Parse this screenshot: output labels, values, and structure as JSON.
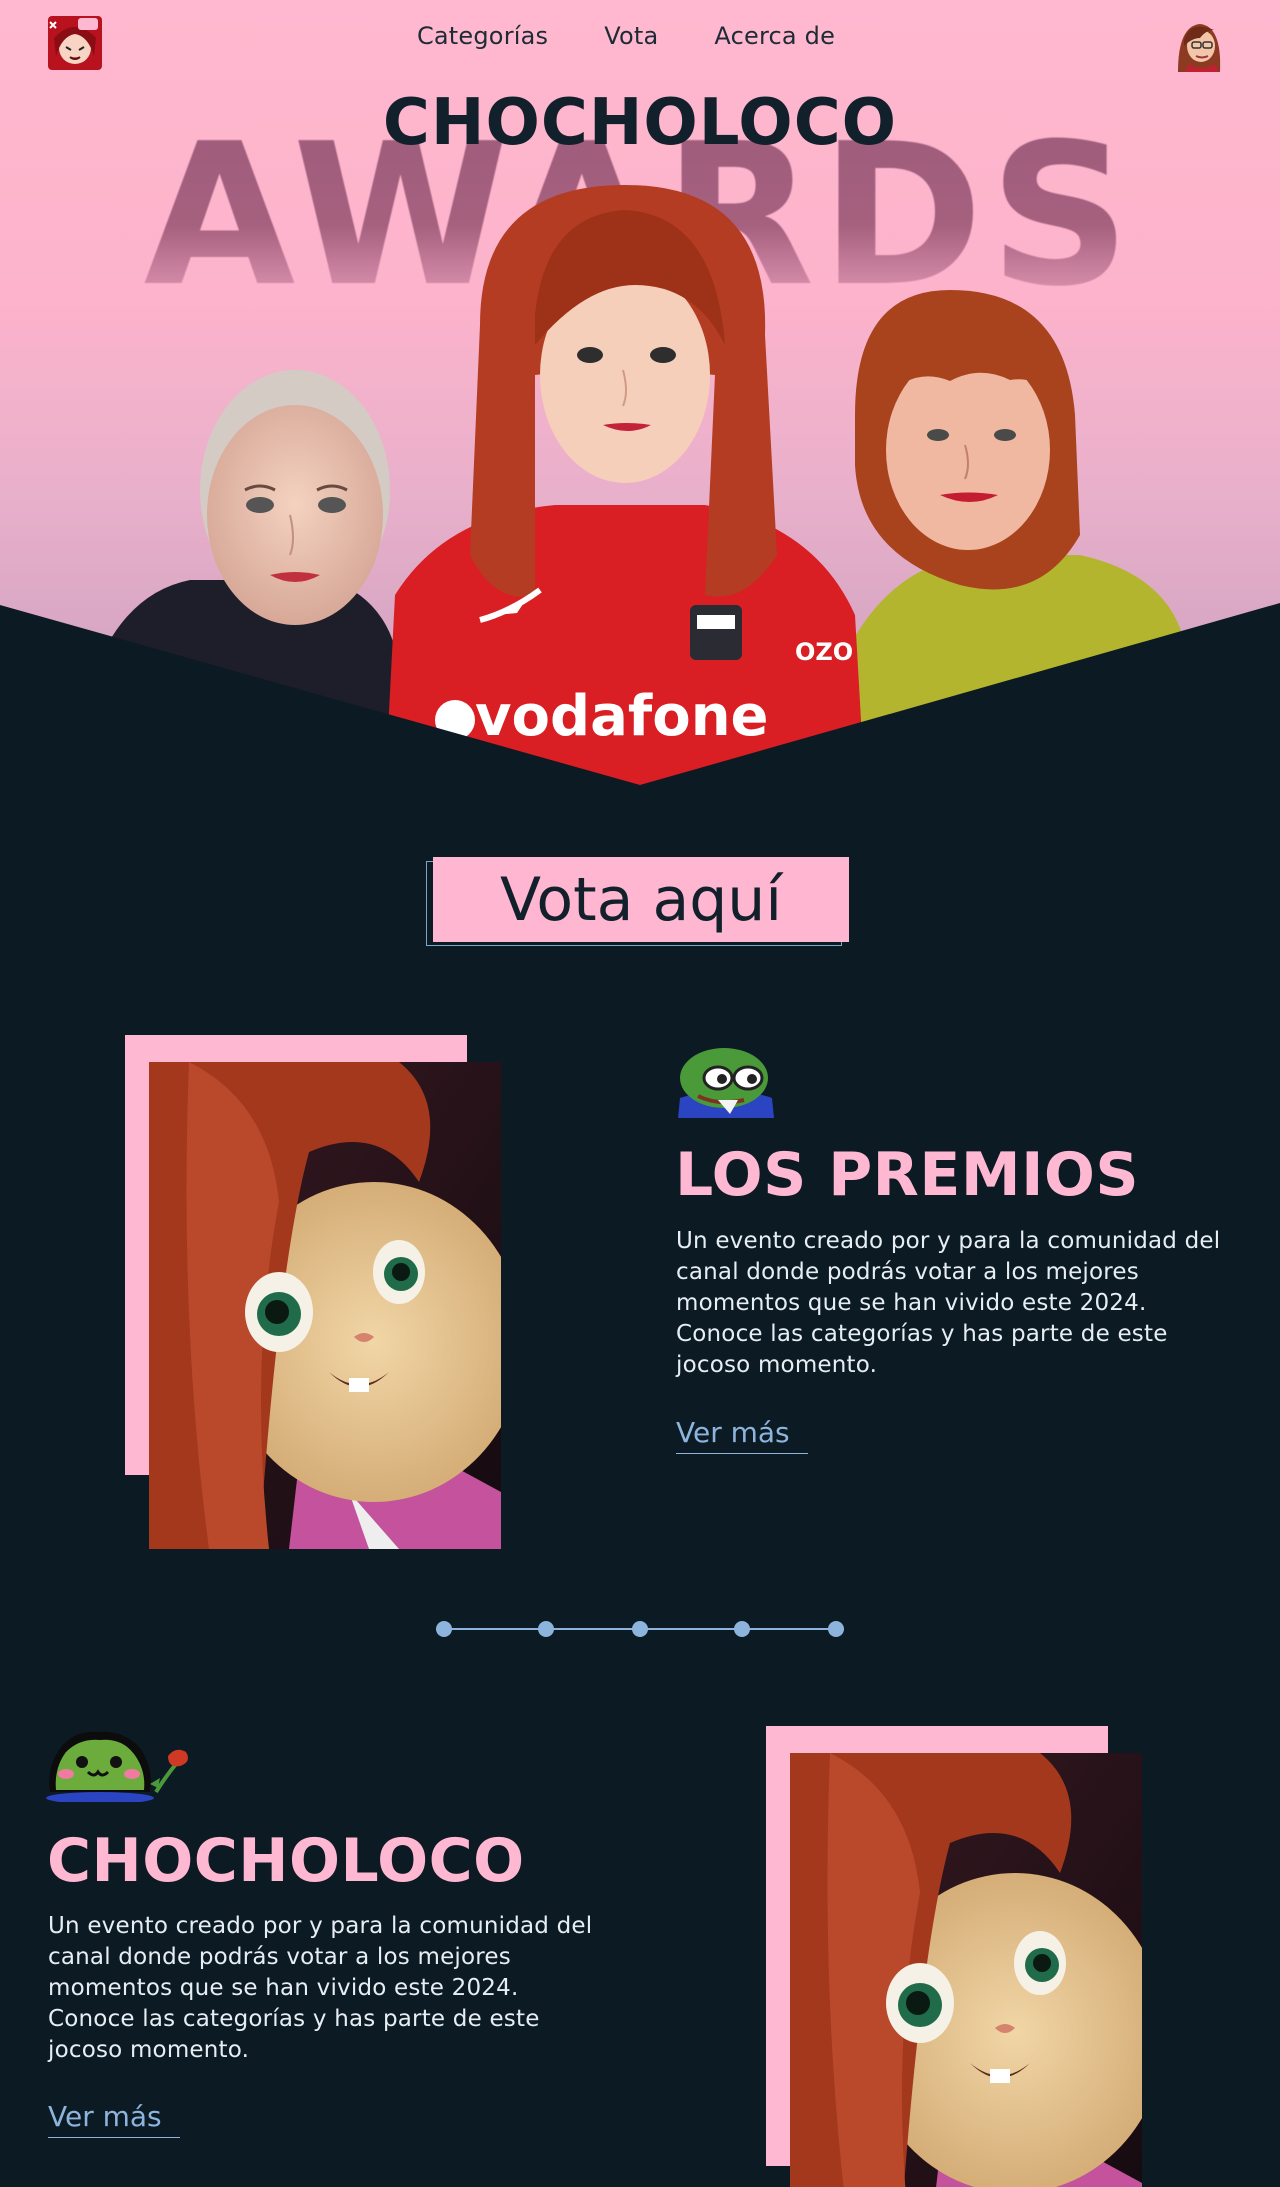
{
  "nav": {
    "logo_icon": "chocoloco-logo-icon",
    "menu": [
      {
        "label": "Categorías"
      },
      {
        "label": "Vota"
      },
      {
        "label": "Acerca de"
      }
    ],
    "avatar_icon": "user-avatar-icon"
  },
  "hero": {
    "title": "CHOCHOLOCO",
    "background_word": "AWARDS",
    "people": [
      "person-left",
      "person-center",
      "person-right"
    ]
  },
  "vote": {
    "label": "Vota aquí"
  },
  "sections": [
    {
      "emote": "pepe-glasses-emote",
      "title": "LOS PREMIOS",
      "text": "Un evento creado por y para la comunidad del canal donde podrás votar a los mejores momentos que se han vivido este 2024. Conoce las categorías y has parte de este jocoso momento.",
      "link": "Ver más",
      "image": "chipmunk-character-image"
    },
    {
      "emote": "frog-flower-emote",
      "title": "CHOCHOLOCO",
      "text": "Un evento creado por y para la comunidad del canal donde podrás votar a los mejores momentos que se han vivido este 2024. Conoce las categorías y has parte de este jocoso momento.",
      "link": "Ver más",
      "image": "chipmunk-character-image"
    }
  ],
  "carousel": {
    "dot_count": 5
  },
  "colors": {
    "pink": "#ffb8d2",
    "navy": "#0c1a24",
    "link_blue": "#8db4dc"
  }
}
